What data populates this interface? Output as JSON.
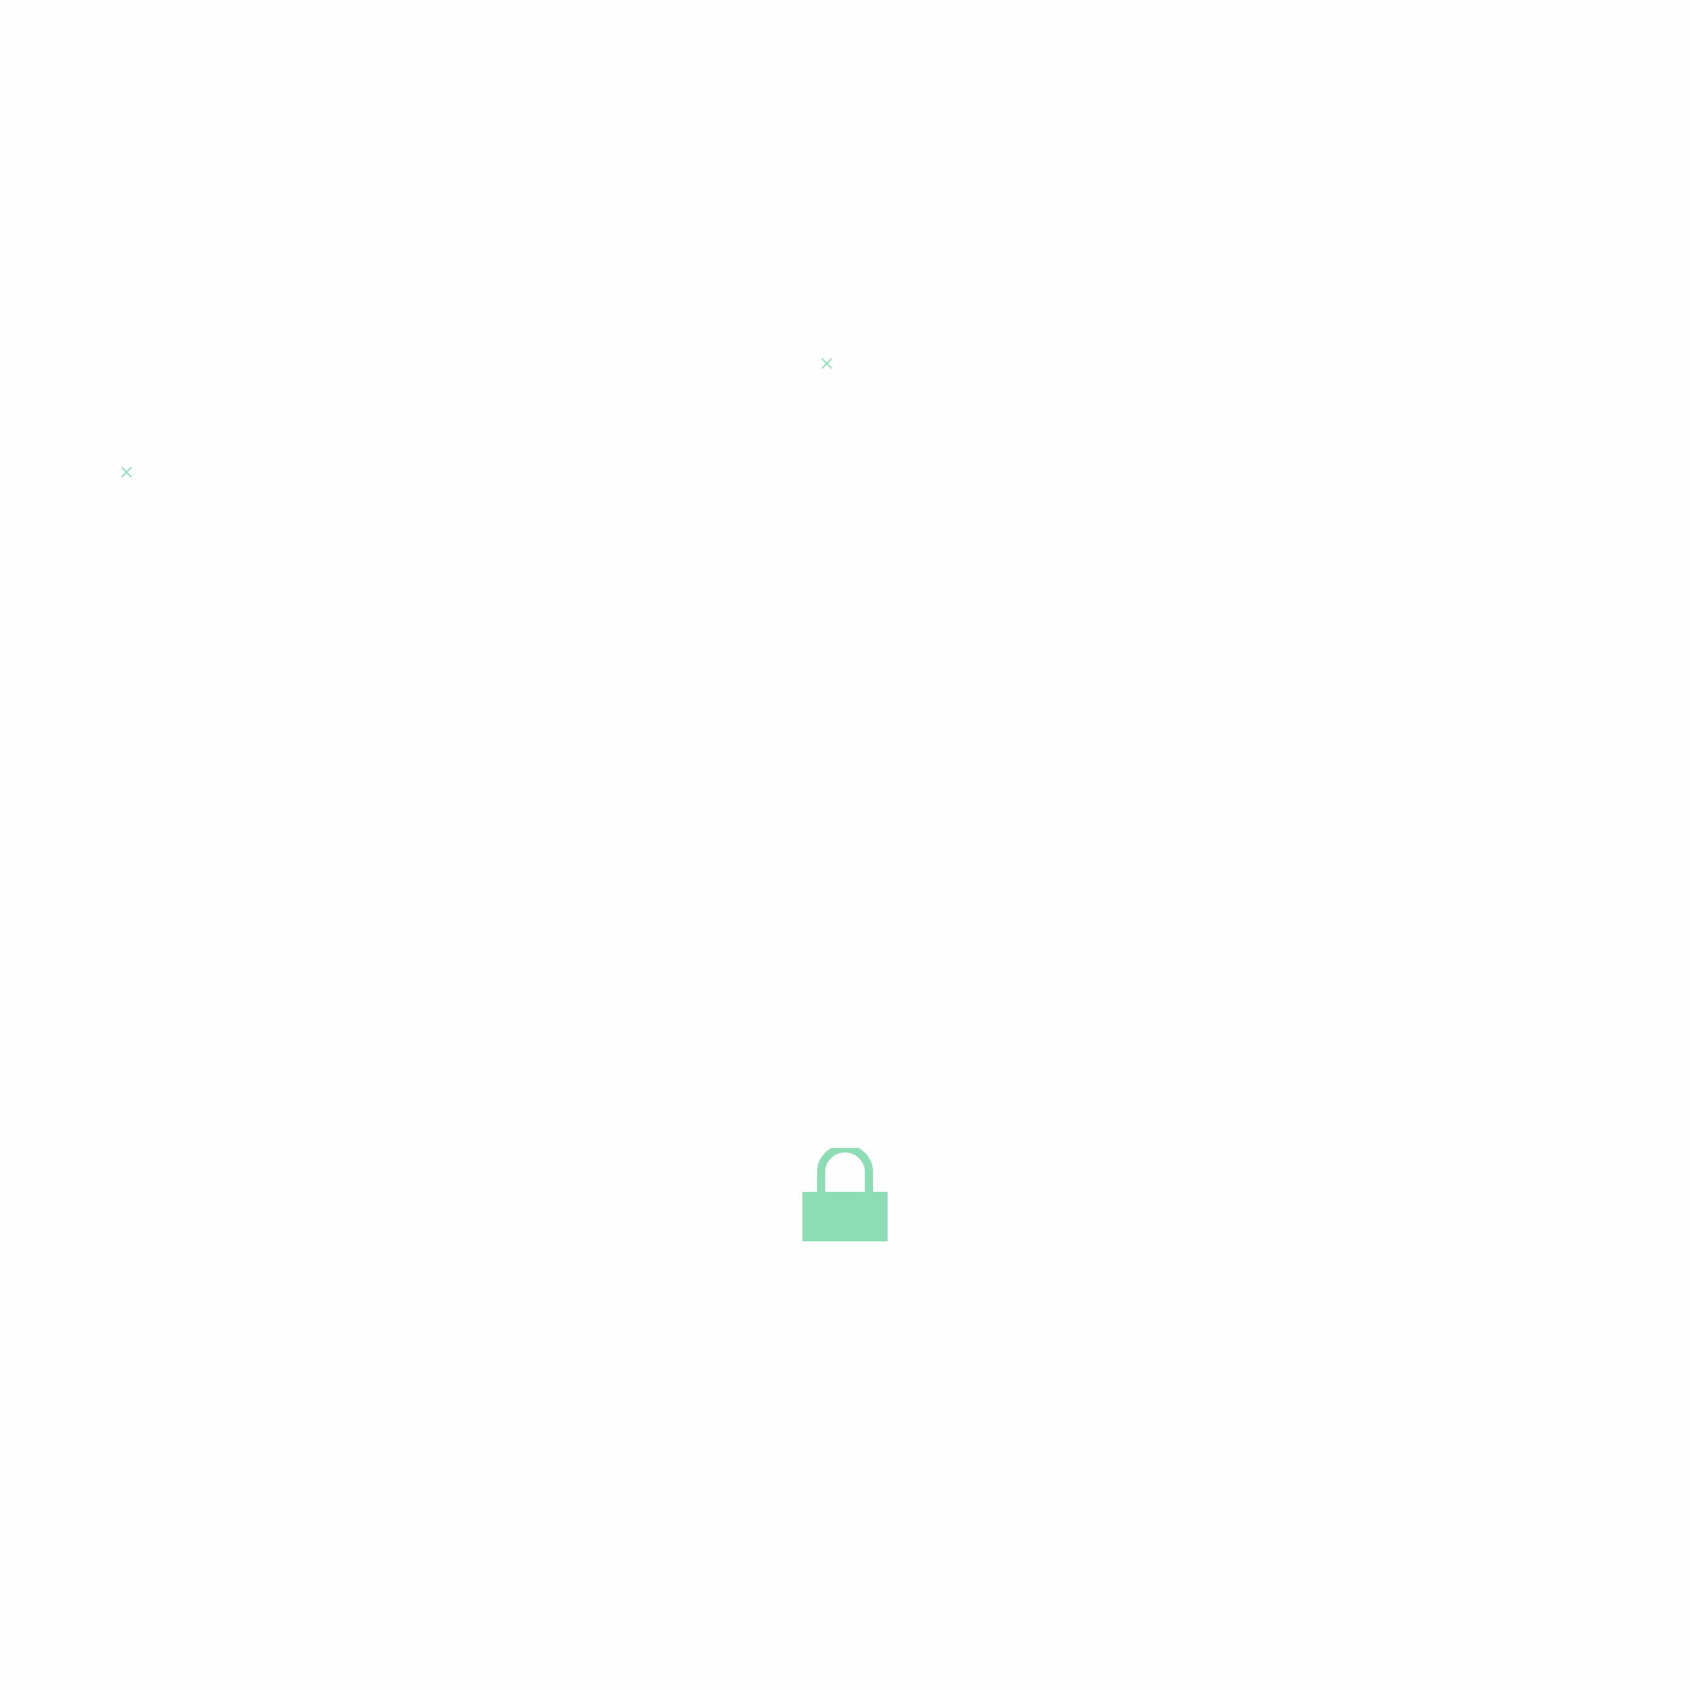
{
  "colors": {
    "background": "#fefefe",
    "accent": "#8cdcb4"
  },
  "icons": {
    "lock": "lock-icon",
    "close_marks": [
      "close-icon",
      "close-icon"
    ]
  }
}
